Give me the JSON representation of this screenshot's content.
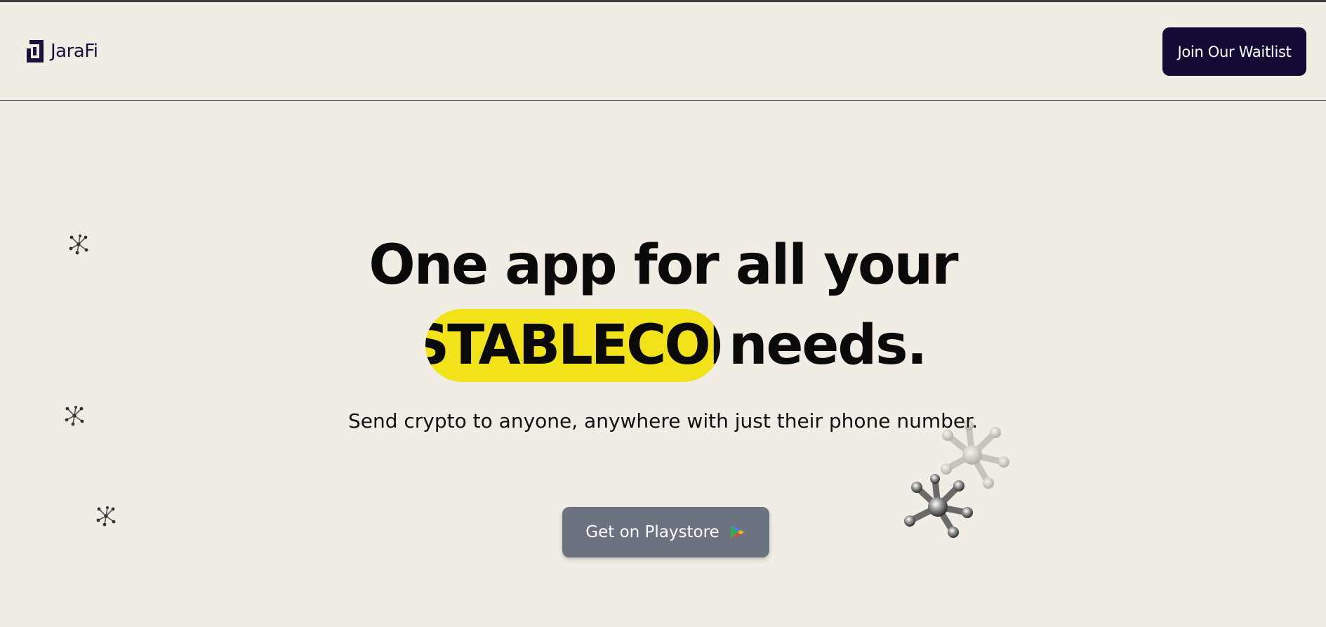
{
  "header": {
    "logo_text": "JaraFi",
    "waitlist_label": "Join Our Waitlist"
  },
  "hero": {
    "line1": "One app for all your",
    "highlight_word": "STABLECOIN",
    "line2_suffix": "needs.",
    "subtitle": "Send crypto to anyone, anywhere with just their phone number.",
    "cta_label": "Get on Playstore",
    "cta_icon": "google-play-icon"
  },
  "colors": {
    "background": "#f1ede4",
    "brand_dark": "#150a36",
    "highlight": "#f2e21a",
    "cta": "#6b7280"
  }
}
